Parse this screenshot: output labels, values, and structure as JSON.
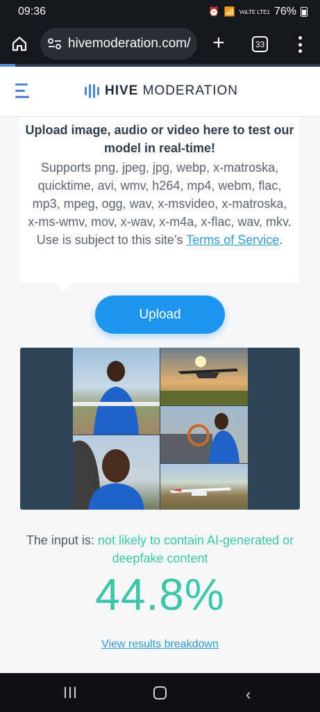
{
  "status_bar": {
    "time": "09:36",
    "battery": "76%",
    "network": "VoLTE LTE1"
  },
  "browser": {
    "url": "hivemoderation.com/",
    "tab_count": "33"
  },
  "header": {
    "brand_bold": "HIVE",
    "brand_rest": "MODERATION"
  },
  "card": {
    "title": "Upload image, audio or video here to test our model in real-time!",
    "description": "Supports png, jpeg, jpg, webp, x-matroska, quicktime, avi, wmv, h264, mp4, webm, flac, mp3, mpeg, ogg, wav, x-msvideo, x-matroska, x-ms-wmv, mov, x-wav, x-m4a, x-flac, wav, mkv. Use is subject to this site’s ",
    "tos_link": "Terms of Service",
    "tail": "."
  },
  "upload": {
    "label": "Upload"
  },
  "result": {
    "prefix": "The input is: ",
    "verdict": "not likely to contain AI-generated or deepfake content",
    "percent": "44.8%",
    "breakdown_link": "View results breakdown"
  },
  "colors": {
    "accent": "#1e96f0",
    "verdict": "#3bc6a8",
    "link": "#2f9ad5",
    "brand": "#4a84d8"
  }
}
